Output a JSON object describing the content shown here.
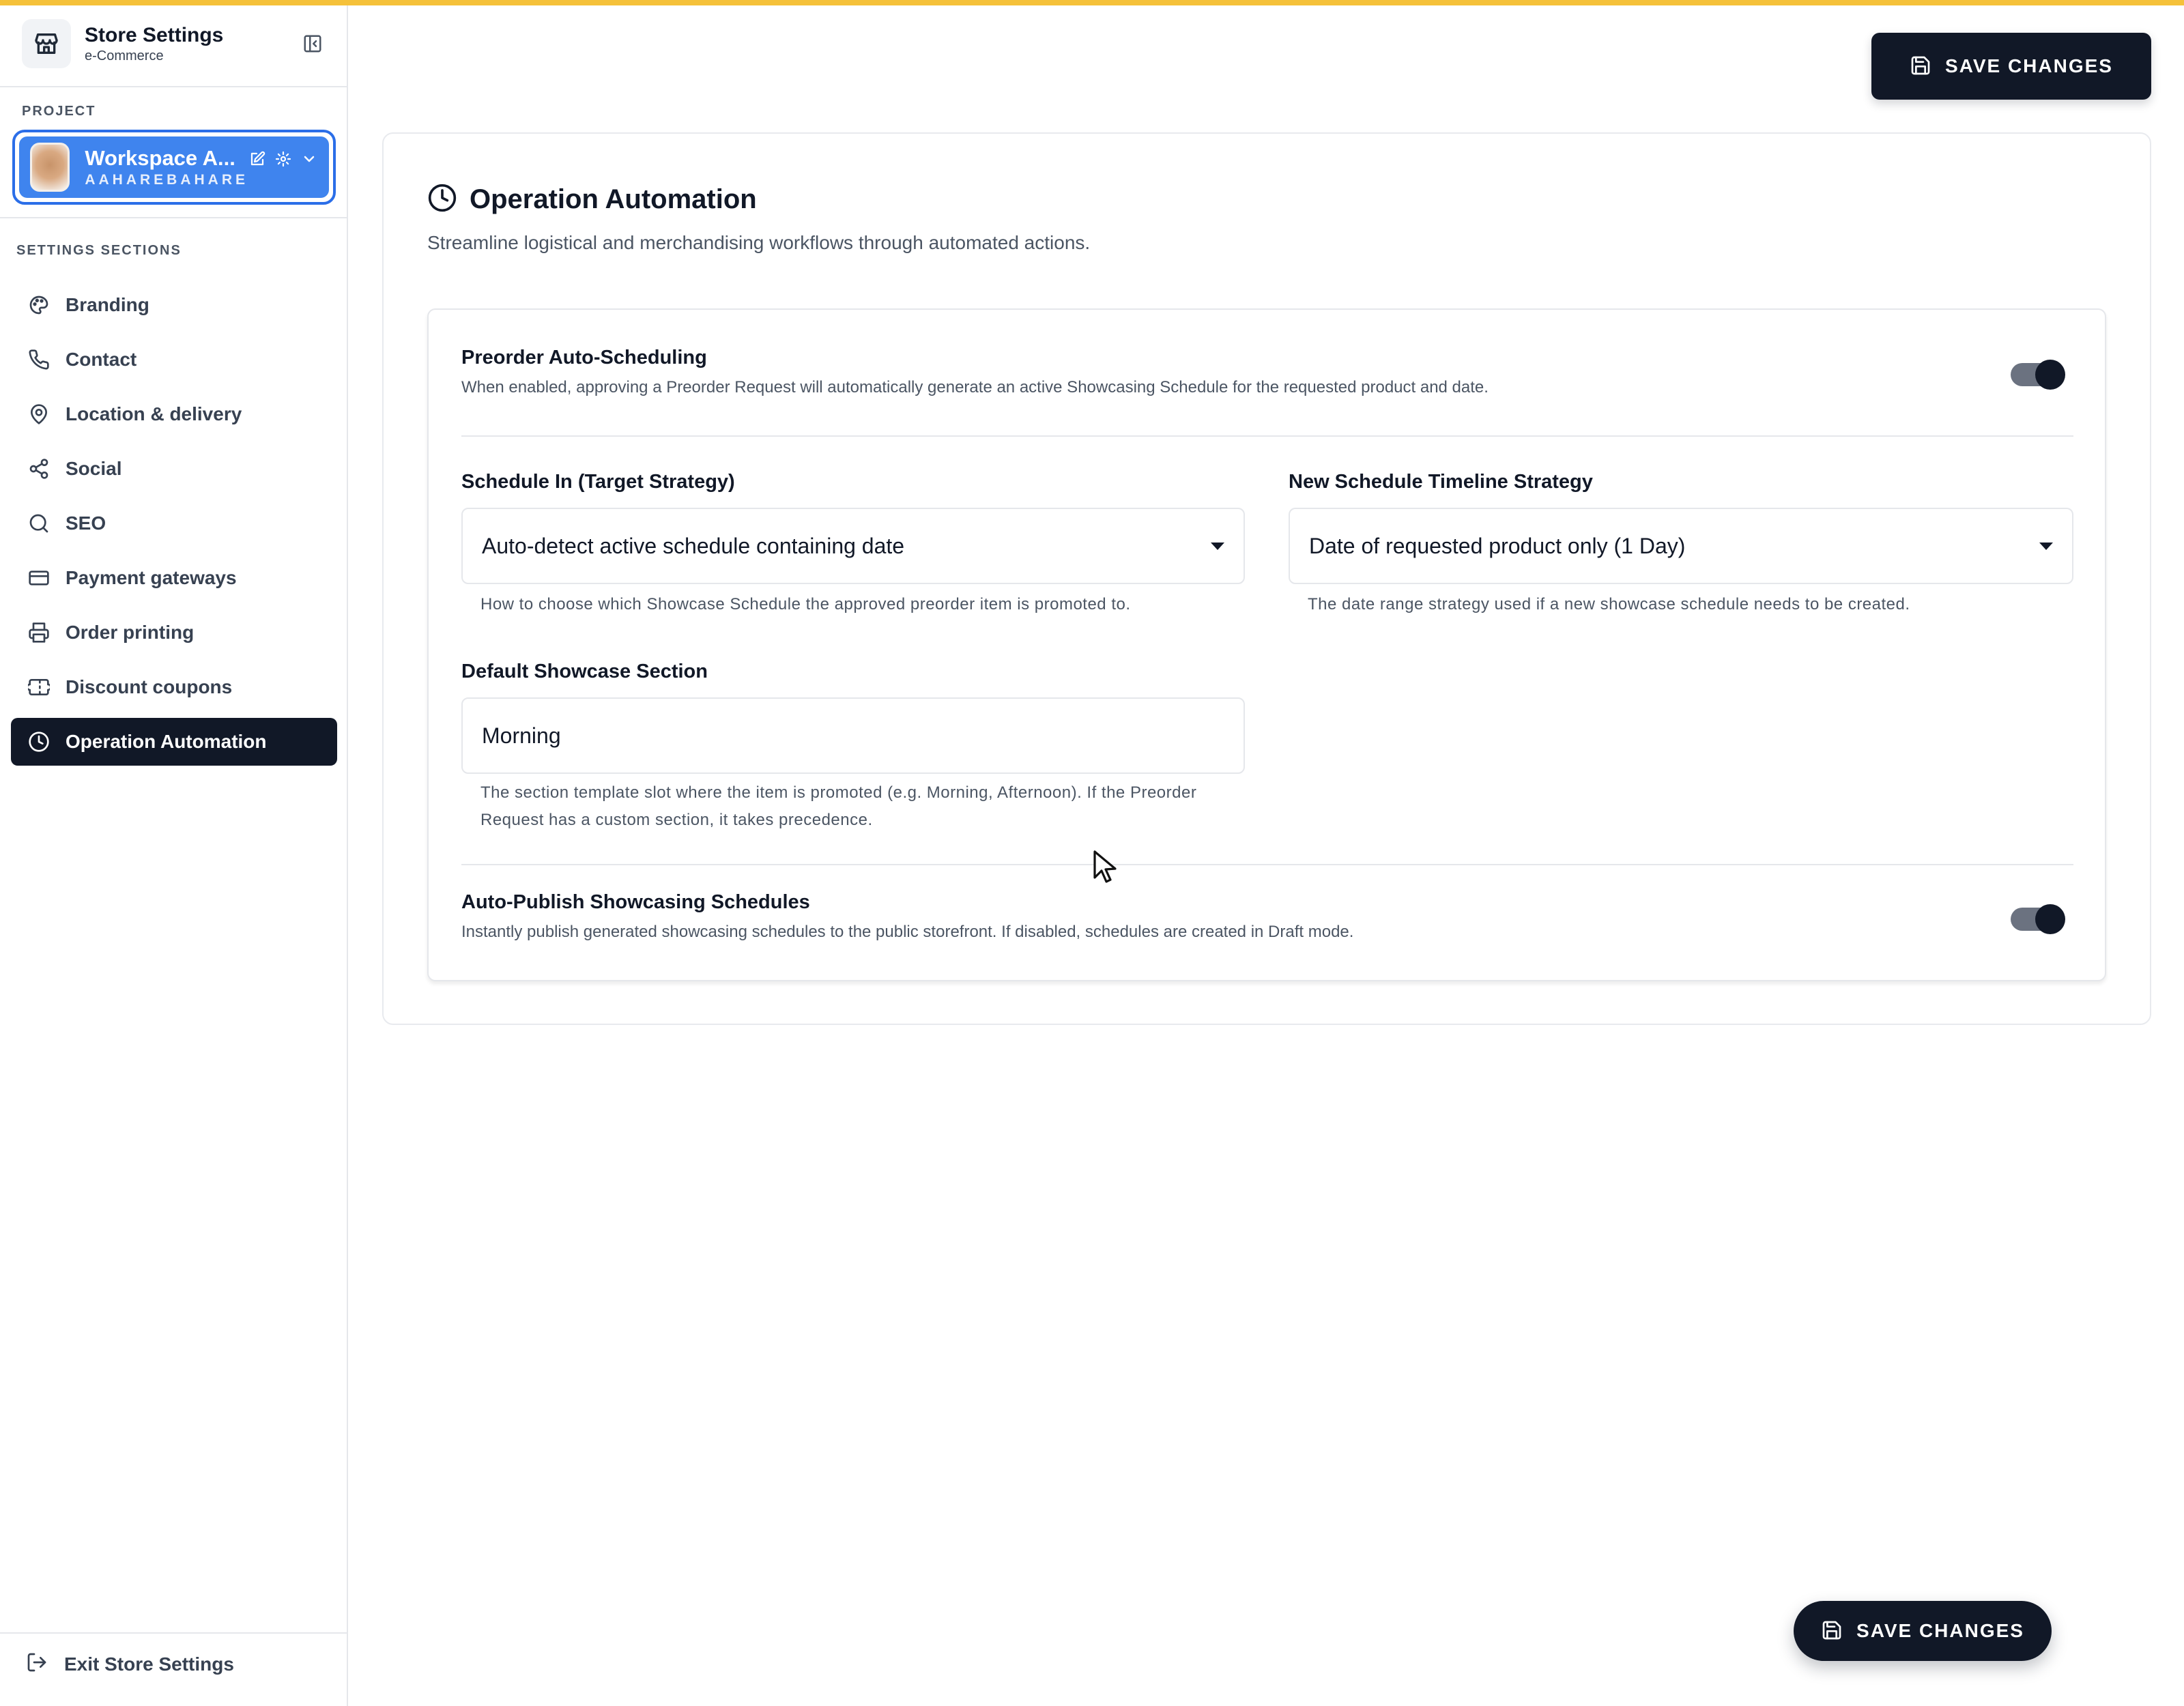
{
  "sidebar": {
    "brand_title": "Store Settings",
    "brand_subtitle": "e-Commerce",
    "project_label": "PROJECT",
    "project": {
      "name": "Workspace A...",
      "slug": "AAHAREBAHARE"
    },
    "sections_label": "SETTINGS SECTIONS",
    "items": [
      {
        "label": "Branding",
        "icon": "palette-icon"
      },
      {
        "label": "Contact",
        "icon": "phone-icon"
      },
      {
        "label": "Location & delivery",
        "icon": "map-pin-icon"
      },
      {
        "label": "Social",
        "icon": "share-icon"
      },
      {
        "label": "SEO",
        "icon": "search-icon"
      },
      {
        "label": "Payment gateways",
        "icon": "credit-card-icon"
      },
      {
        "label": "Order printing",
        "icon": "printer-icon"
      },
      {
        "label": "Discount coupons",
        "icon": "ticket-icon"
      },
      {
        "label": "Operation Automation",
        "icon": "clock-icon",
        "active": true
      }
    ],
    "exit_label": "Exit Store Settings"
  },
  "header": {
    "save_label": "SAVE CHANGES"
  },
  "panel": {
    "title": "Operation Automation",
    "description": "Streamline logistical and merchandising workflows through automated actions."
  },
  "settings": {
    "preorder": {
      "title": "Preorder Auto-Scheduling",
      "description": "When enabled, approving a Preorder Request will automatically generate an active Showcasing Schedule for the requested product and date.",
      "enabled": true
    },
    "schedule_in": {
      "label": "Schedule In (Target Strategy)",
      "value": "Auto-detect active schedule containing date",
      "help": "How to choose which Showcase Schedule the approved preorder item is promoted to."
    },
    "timeline": {
      "label": "New Schedule Timeline Strategy",
      "value": "Date of requested product only (1 Day)",
      "help": "The date range strategy used if a new showcase schedule needs to be created."
    },
    "section": {
      "label": "Default Showcase Section",
      "value": "Morning",
      "help_line1": "The section template slot where the item is promoted (e.g. Morning, Afternoon). If the Preorder",
      "help_line2": "Request has a custom section, it takes precedence."
    },
    "autopublish": {
      "title": "Auto-Publish Showcasing Schedules",
      "description": "Instantly publish generated showcasing schedules to the public storefront. If disabled, schedules are created in Draft mode.",
      "enabled": true
    }
  },
  "footer": {
    "save_label": "SAVE CHANGES"
  },
  "colors": {
    "accent_bar": "#f5c13a",
    "primary_dark": "#111827",
    "project_blue": "#3f84ee"
  }
}
